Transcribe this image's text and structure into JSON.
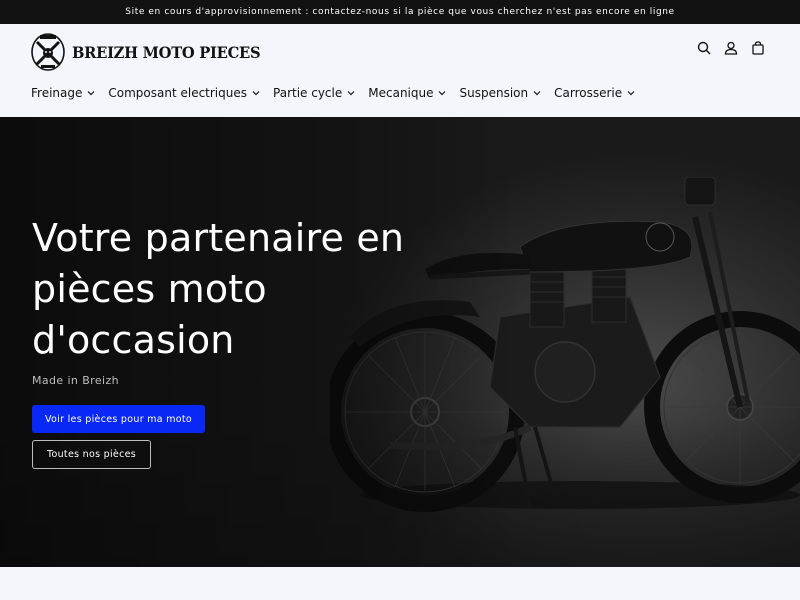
{
  "announcement": {
    "text": "Site en cours d'approvisionnement : contactez-nous si la pièce que vous cherchez n'est pas encore en ligne"
  },
  "header": {
    "logo_text": "BREIZH MOTO PIECES",
    "icons": [
      "search-icon",
      "account-icon",
      "cart-icon"
    ]
  },
  "nav": {
    "items": [
      {
        "label": "Freinage"
      },
      {
        "label": "Composant electriques"
      },
      {
        "label": "Partie cycle"
      },
      {
        "label": "Mecanique"
      },
      {
        "label": "Suspension"
      },
      {
        "label": "Carrosserie"
      }
    ]
  },
  "hero": {
    "title_line1": "Votre partenaire en",
    "title_line2": "pièces moto",
    "title_line3": "d'occasion",
    "subtitle": "Made in Breizh",
    "primary_button": "Voir les pièces pour ma moto",
    "secondary_button": "Toutes nos pièces"
  },
  "colors": {
    "announcement_bg": "#121212",
    "header_bg": "#f3f6fa",
    "primary_button_bg": "#0a28f5",
    "hero_bg": "#1a1a1a"
  }
}
